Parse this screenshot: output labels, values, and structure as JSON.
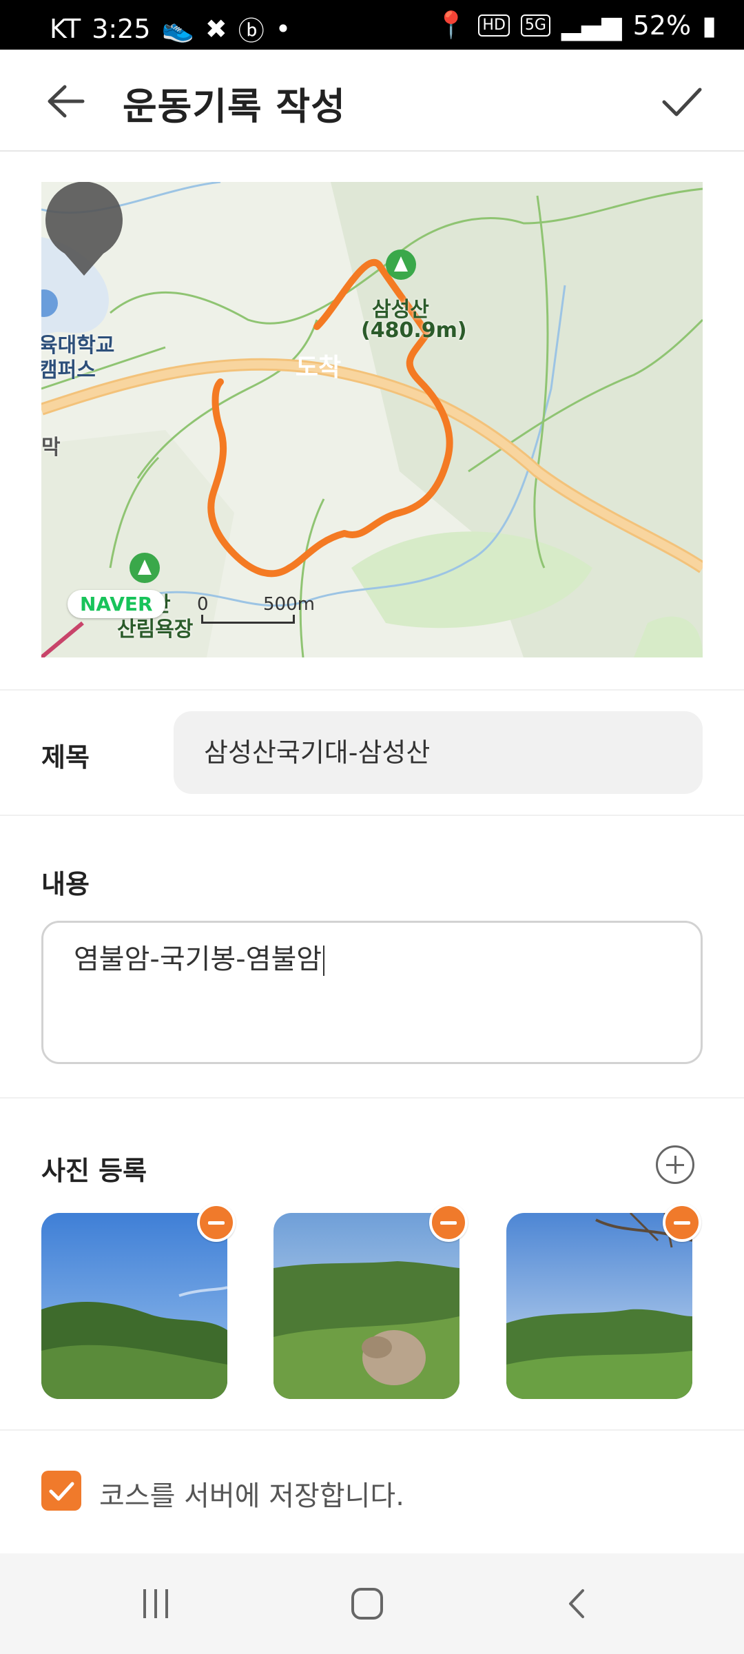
{
  "status_bar": {
    "carrier": "KT",
    "time": "3:25",
    "network_badges": [
      "HD",
      "5G"
    ],
    "battery": "52%"
  },
  "header": {
    "title": "운동기록 작성",
    "back_icon": "arrow-left-icon",
    "confirm_icon": "check-icon"
  },
  "map": {
    "provider_badge": "NAVER",
    "pin_label": "도착",
    "peak_label_1": "삼성산",
    "peak_label_2": "(480.9m)",
    "left_label_1": "육대학교",
    "left_label_2": "캠퍼스",
    "left_label_3": "막",
    "bottom_label_1": "산",
    "bottom_label_2": "산림욕장",
    "scale_zero": "0",
    "scale_distance": "500m",
    "route_color": "#f47a23"
  },
  "form": {
    "title_label": "제목",
    "title_value": "삼성산국기대-삼성산",
    "content_label": "내용",
    "content_value": "염불암-국기봉-염불암",
    "photos_label": "사진 등록",
    "save_course_label": "코스를 서버에 저장합니다.",
    "save_course_checked": true
  },
  "photos": [
    {
      "name": "mountain-photo-1"
    },
    {
      "name": "mountain-photo-2"
    },
    {
      "name": "mountain-photo-3"
    }
  ],
  "colors": {
    "accent": "#f07a2b"
  }
}
